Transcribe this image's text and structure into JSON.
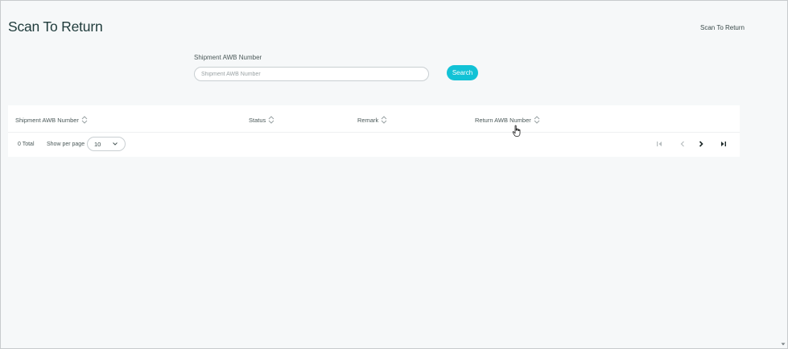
{
  "page": {
    "title": "Scan To Return",
    "breadcrumb": "Scan To Return"
  },
  "search": {
    "label": "Shipment AWB Number",
    "placeholder": "Shipment AWB Number",
    "value": "",
    "button_label": "Search"
  },
  "table": {
    "columns": [
      {
        "label": "Shipment AWB Number",
        "sortable": true
      },
      {
        "label": "Status",
        "sortable": true
      },
      {
        "label": "Remark",
        "sortable": true
      },
      {
        "label": "Return AWB Number",
        "sortable": true
      }
    ],
    "rows": []
  },
  "footer": {
    "total_label": "0 Total",
    "per_page_label": "Show per page",
    "per_page_value": "10",
    "pager": {
      "first_icon": "first-page-icon",
      "prev_icon": "prev-page-icon",
      "next_icon": "next-page-icon",
      "last_icon": "last-page-icon"
    }
  },
  "colors": {
    "accent": "#12c2d6",
    "background": "#f6f8f9",
    "panel": "#ffffff",
    "title": "#1f3b3b"
  }
}
